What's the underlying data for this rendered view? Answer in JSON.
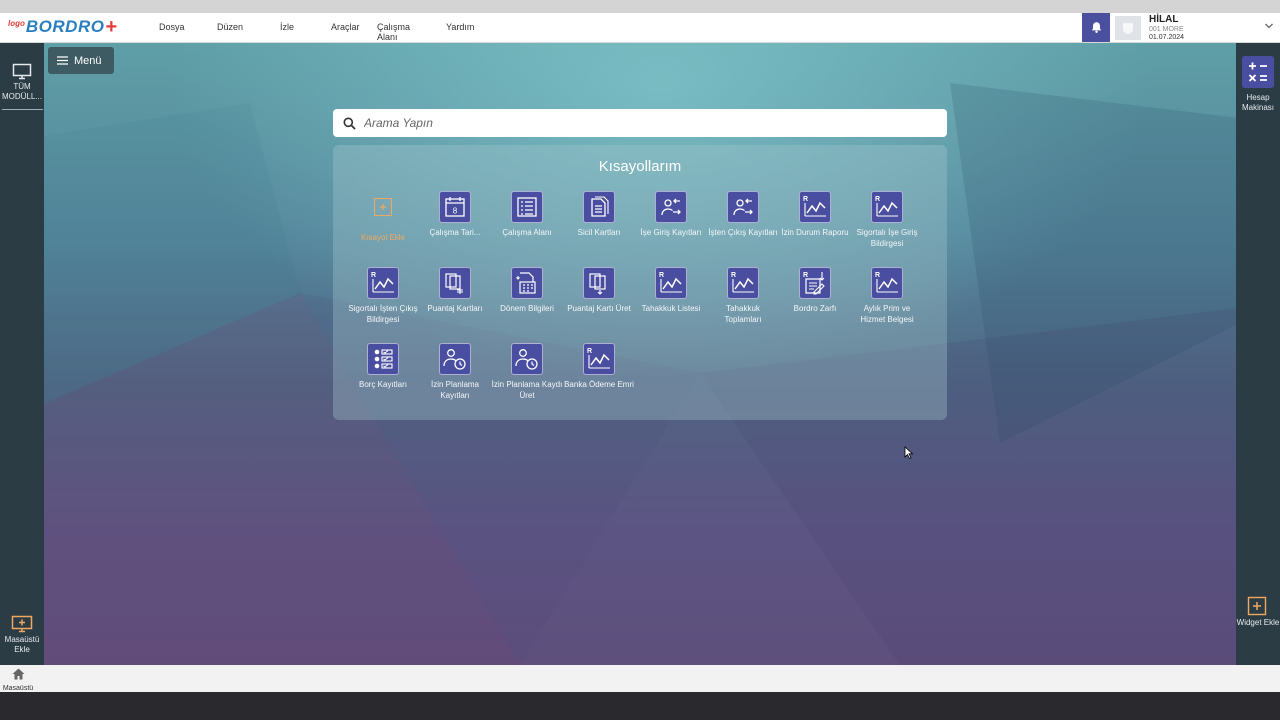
{
  "app": {
    "logo_small": "logo",
    "logo_main": "BORDRO",
    "logo_plus": "+"
  },
  "menu": [
    "Dosya",
    "Düzen",
    "İzle",
    "Araçlar",
    "Çalışma Alanı",
    "Yardım"
  ],
  "user": {
    "name": "HİLAL",
    "company": "001 MORE",
    "date": "01.07.2024"
  },
  "left_sidebar": {
    "all_modules": "TÜM MODÜLL...",
    "add_desktop": "Masaüstü Ekle"
  },
  "right_sidebar": {
    "calculator": "Hesap Makinası",
    "add_widget": "Widget Ekle"
  },
  "menu_button": {
    "label": "Menü"
  },
  "search": {
    "placeholder": "Arama Yapın"
  },
  "shortcuts_panel": {
    "title": "Kısayollarım",
    "add_label": "Kısayol Ekle",
    "items": [
      {
        "label": "Çalışma Tari...",
        "icon": "calendar-icon"
      },
      {
        "label": "Çalışma Alanı",
        "icon": "list-icon"
      },
      {
        "label": "Sicil Kartları",
        "icon": "document-icon"
      },
      {
        "label": "İşe Giriş Kayıtları",
        "icon": "person-in-icon"
      },
      {
        "label": "İşten Çıkış Kayıtları",
        "icon": "person-out-icon"
      },
      {
        "label": "İzin Durum Raporu",
        "icon": "report-icon"
      },
      {
        "label": "Sigortalı İşe Giriş Bildirgesi",
        "icon": "report-icon"
      },
      {
        "label": "Sigortalı İşten Çıkış Bildirgesi",
        "icon": "report-icon"
      },
      {
        "label": "Puantaj Kartları",
        "icon": "cards-icon"
      },
      {
        "label": "Dönem Bilgileri",
        "icon": "period-icon"
      },
      {
        "label": "Puantaj Kartı Üret",
        "icon": "cards-generate-icon"
      },
      {
        "label": "Tahakkuk Listesi",
        "icon": "report-icon"
      },
      {
        "label": "Tahakkuk Toplamları",
        "icon": "report-icon"
      },
      {
        "label": "Bordro Zarfı",
        "icon": "envelope-icon"
      },
      {
        "label": "Aylık Prim ve Hizmet Belgesi",
        "icon": "report-icon"
      },
      {
        "label": "Borç Kayıtları",
        "icon": "checklist-icon"
      },
      {
        "label": "İzin Planlama Kayıtları",
        "icon": "leave-plan-icon"
      },
      {
        "label": "İzin Planlama Kaydı Üret",
        "icon": "leave-plan-icon"
      },
      {
        "label": "Banka Ödeme Emri",
        "icon": "report-icon"
      }
    ]
  },
  "bottom_bar": {
    "home_label": "Masaüstü"
  },
  "colors": {
    "accent": "#4a4ea0",
    "header_bell": "#4b4fa0",
    "add_shortcut": "#f0a860",
    "sidebar": "#2c3c44"
  }
}
